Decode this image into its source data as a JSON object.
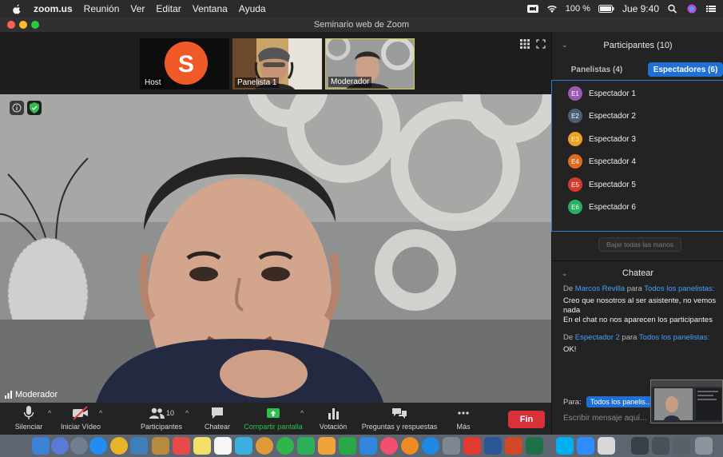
{
  "menubar": {
    "app": "zoom.us",
    "items": [
      "Reunión",
      "Ver",
      "Editar",
      "Ventana",
      "Ayuda"
    ],
    "battery": "100 %",
    "clock": "Jue 9:40"
  },
  "window": {
    "title": "Seminario web de Zoom"
  },
  "thumbnails": [
    {
      "label": "Host",
      "initial": "S"
    },
    {
      "label": "Panelista 1"
    },
    {
      "label": "Moderador"
    }
  ],
  "main_video": {
    "label": "Moderador"
  },
  "toolbar": {
    "mute": "Silenciar",
    "video": "Iniciar Vídeo",
    "participants": "Participantes",
    "participants_count": "10",
    "chat": "Chatear",
    "share": "Compartir pantalla",
    "poll": "Votación",
    "qa": "Preguntas y respuestas",
    "more": "Más",
    "end": "Fin"
  },
  "panel": {
    "title": "Participantes (10)",
    "tab_panelists": "Panelistas (4)",
    "tab_attendees": "Espectadores (6)",
    "attendees": [
      {
        "initials": "E1",
        "name": "Espectador 1",
        "color": "#9b59b6"
      },
      {
        "initials": "E2",
        "name": "Espectador 2",
        "color": "#4a6175"
      },
      {
        "initials": "E3",
        "name": "Espectador 3",
        "color": "#f0a01e"
      },
      {
        "initials": "E4",
        "name": "Espectador 4",
        "color": "#e26a1c"
      },
      {
        "initials": "E5",
        "name": "Espectador 5",
        "color": "#d63a2f"
      },
      {
        "initials": "E6",
        "name": "Espectador 6",
        "color": "#27ae60"
      }
    ],
    "lower_all": "Bajar todas las manos"
  },
  "chat": {
    "title": "Chatear",
    "messages": [
      {
        "prefix": "De",
        "sender": "Marcos Revilla",
        "to_word": "para",
        "recipient": "Todos los panelistas",
        "lines": [
          "Creo que nosotros al ser asistente, no vemos nada",
          "En el chat no nos aparecen los participantes"
        ]
      },
      {
        "prefix": "De",
        "sender": "Espectador 2",
        "to_word": "para",
        "recipient": "Todos los panelistas",
        "lines": [
          "OK!"
        ]
      }
    ],
    "to_label": "Para:",
    "to_value": "Todos los panelis...",
    "input_placeholder": "Escribir mensaje aquí..."
  },
  "colors": {
    "accent": "#1f6fd4",
    "end_button": "#d9313a",
    "share_green": "#2fbf4a",
    "host_avatar": "#f05a28"
  }
}
